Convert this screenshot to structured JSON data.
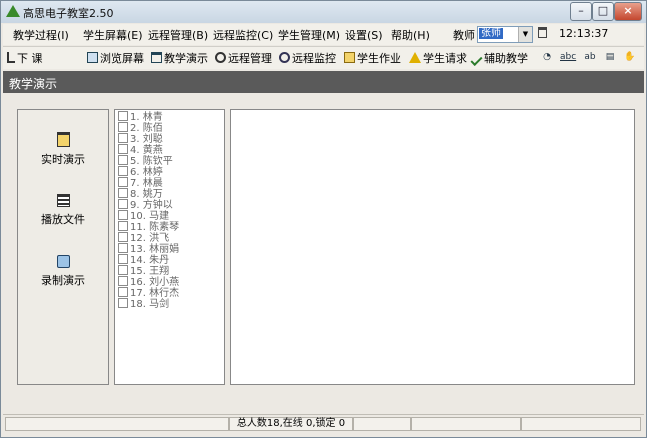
{
  "window": {
    "title": "高思电子教室2.50"
  },
  "menu": [
    "教学过程(I)",
    "学生屏幕(E)",
    "远程管理(B)",
    "远程监控(C)",
    "学生管理(M)",
    "设置(S)",
    "帮助(H)"
  ],
  "teacher": {
    "label": "教师",
    "value": "张师"
  },
  "clock": "12:13:37",
  "toolbar": {
    "class_end": "下   课",
    "buttons": [
      "浏览屏幕",
      "教学演示",
      "远程管理",
      "远程监控",
      "学生作业",
      "学生请求",
      "辅助教学"
    ]
  },
  "section": {
    "title": "教学演示"
  },
  "actions": [
    "实时演示",
    "播放文件",
    "录制演示"
  ],
  "students": [
    "1. 林青",
    "2. 陈佰",
    "3. 刘聪",
    "4. 黄燕",
    "5. 陈钦平",
    "6. 林婷",
    "7. 林晨",
    "8. 姚万",
    "9. 方钟以",
    "10. 马建",
    "11. 陈素琴",
    "12. 洪飞",
    "13. 林丽娟",
    "14. 朱丹",
    "15. 王翔",
    "16. 刘小燕",
    "17. 林行杰",
    "18. 马剑"
  ],
  "status": {
    "text": "总人数18,在线 0,锁定 0"
  },
  "colors": {
    "header_bg": "#5a5a5a",
    "selection": "#316ac5"
  }
}
